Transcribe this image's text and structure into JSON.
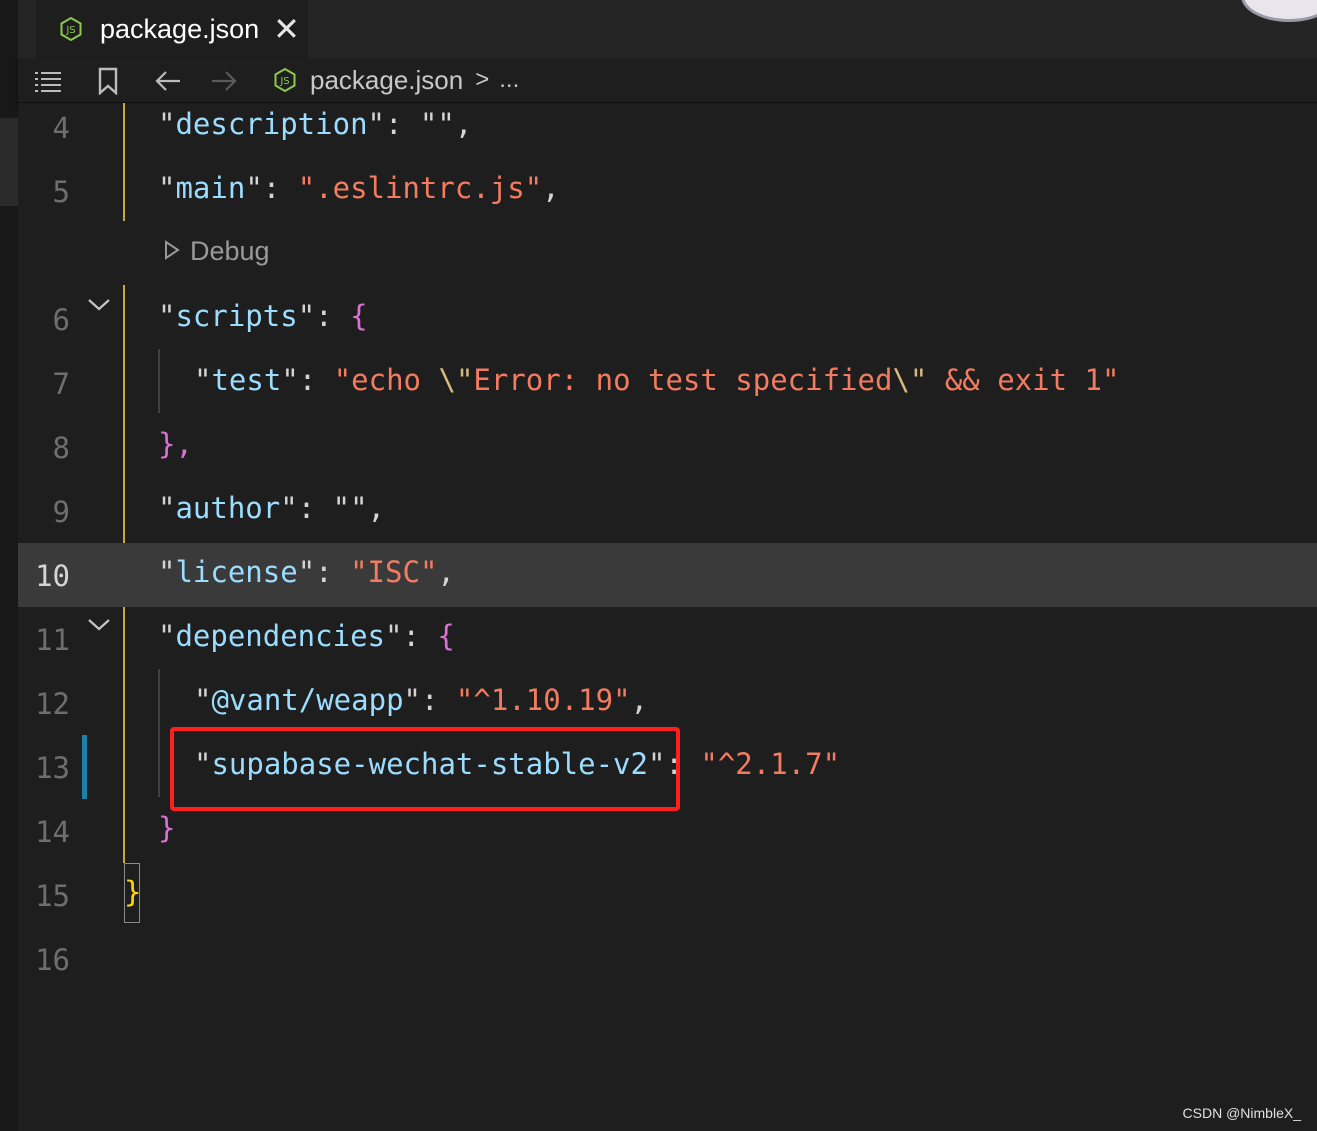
{
  "tab": {
    "file_icon": "nodejs-icon",
    "label": "package.json",
    "close_icon": "close-icon",
    "close_glyph": "✕"
  },
  "toolbar": {
    "outline_icon": "list-icon",
    "bookmark_icon": "bookmark-icon",
    "back_icon": "arrow-left-icon",
    "forward_icon": "arrow-right-icon",
    "breadcrumb": {
      "file_icon": "nodejs-icon",
      "file": "package.json",
      "separator": ">",
      "more": "..."
    }
  },
  "codelens": {
    "icon": "play-outline-icon",
    "label": "Debug"
  },
  "lines": [
    {
      "num": "4",
      "key": "description",
      "value": ""
    },
    {
      "num": "5",
      "key": "main",
      "value": ".eslintrc.js"
    },
    {
      "num": "6",
      "key": "scripts",
      "open": "{"
    },
    {
      "num": "7",
      "key": "test",
      "value_a": "echo ",
      "esc_a": "\\\"",
      "value_b": "Error: no test specified",
      "esc_b": "\\\"",
      "value_c": " && exit 1"
    },
    {
      "num": "8",
      "close": "},"
    },
    {
      "num": "9",
      "key": "author",
      "value": ""
    },
    {
      "num": "10",
      "key": "license",
      "value": "ISC"
    },
    {
      "num": "11",
      "key": "dependencies",
      "open": "{"
    },
    {
      "num": "12",
      "key": "@vant/weapp",
      "value": "^1.10.19"
    },
    {
      "num": "13",
      "key": "supabase-wechat-stable-v2",
      "value": "^2.1.7"
    },
    {
      "num": "14",
      "close": "}"
    },
    {
      "num": "15",
      "close": "}"
    },
    {
      "num": "16"
    }
  ],
  "current_line": "10",
  "watermark": "CSDN @NimbleX_",
  "colors": {
    "key": "#9cdcfe",
    "string": "#f27b60",
    "escape": "#d7ba7d",
    "brace": "#da70d6",
    "outer_brace": "#ffd700",
    "highlight_box": "#ff1f1f",
    "modified_gutter": "#1b81a8"
  }
}
